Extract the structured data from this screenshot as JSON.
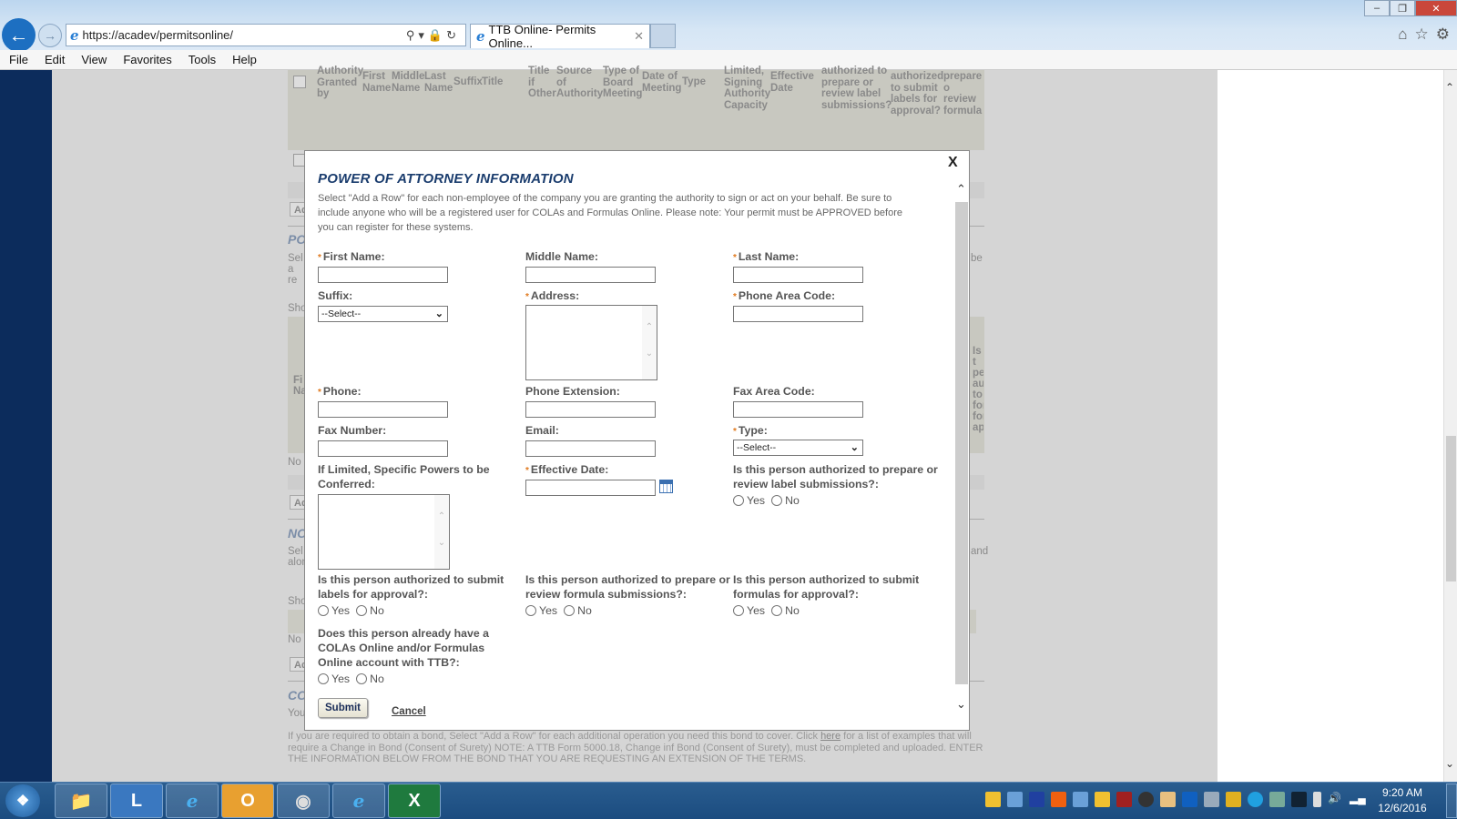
{
  "browser": {
    "url": "https://acadev/permitsonline/",
    "tab_title": "TTB Online- Permits Online...",
    "menu": [
      "File",
      "Edit",
      "View",
      "Favorites",
      "Tools",
      "Help"
    ]
  },
  "background_page": {
    "table_headers": [
      "Authority Granted by",
      "First Name",
      "Middle Name",
      "Last Name",
      "Suffix",
      "Title",
      "Title if Other",
      "Source of Authority",
      "Type of Board Meeting",
      "Date of Meeting",
      "Type",
      "Limited, Signing Authority Capacity",
      "Effective Date",
      "authorized to prepare or review label submissions?",
      "authorized to submit labels for approval?",
      "prepare o review formula submissi"
    ],
    "fragments": {
      "add_btn": "Ad",
      "po_heading": "PO",
      "po_desc": "Sel a re",
      "show1": "Sho",
      "fi_na": "Fi Na",
      "no1": "No",
      "no_heading": "NO",
      "no_desc": "Sel alon",
      "show2": "Sho",
      "no2": "No",
      "co_heading": "CO",
      "you": "You",
      "be": "be",
      "is_col": "Is t pe au to for for ap",
      "and": "and"
    },
    "bond_text_before": "If you are required to obtain a bond, Select \"Add a Row\" for each additional operation you need this bond to cover. Click ",
    "bond_link": "here",
    "bond_text_after": " for a list of examples that will require a Change in Bond (Consent of Surety) NOTE: A TTB Form 5000.18, Change inf Bond (Consent of Surety), must be completed and uploaded. ENTER THE INFORMATION BELOW FROM THE BOND THAT YOU ARE REQUESTING AN EXTENSION OF THE TERMS."
  },
  "modal": {
    "title": "POWER OF ATTORNEY INFORMATION",
    "close": "X",
    "intro": "Select \"Add a Row\" for each non-employee of the company you are granting the authority to sign or act on your behalf. Be sure to include anyone who will be a registered user for COLAs and Formulas Online. Please note: Your permit must be APPROVED before you can register for these systems.",
    "required_marker": "*",
    "labels": {
      "first_name": "First Name:",
      "middle_name": "Middle Name:",
      "last_name": "Last Name:",
      "suffix": "Suffix:",
      "address": "Address:",
      "phone_area": "Phone Area Code:",
      "phone": "Phone:",
      "phone_ext": "Phone Extension:",
      "fax_area": "Fax Area Code:",
      "fax_number": "Fax Number:",
      "email": "Email:",
      "type": "Type:",
      "specific_powers": "If Limited, Specific Powers to be Conferred:",
      "effective_date": "Effective Date:",
      "q_prepare_label": "Is this person authorized to prepare or review label submissions?:",
      "q_submit_label": "Is this person authorized to submit labels for approval?:",
      "q_prepare_formula": "Is this person authorized to prepare or review formula submissions?:",
      "q_submit_formula": "Is this person authorized to submit formulas for approval?:",
      "q_existing_account": "Does this person already have a COLAs Online and/or Formulas Online account with TTB?:"
    },
    "values": {
      "first_name": "",
      "middle_name": "",
      "last_name": "",
      "address": "",
      "phone_area": "",
      "phone": "",
      "phone_ext": "",
      "fax_area": "",
      "fax_number": "",
      "email": "",
      "specific_powers": "",
      "effective_date": ""
    },
    "suffix_selected": "--Select--",
    "type_selected": "--Select--",
    "yes": "Yes",
    "no": "No",
    "submit": "Submit",
    "cancel": "Cancel"
  },
  "taskbar": {
    "apps": [
      "file-explorer",
      "lync",
      "internet-explorer",
      "outlook",
      "app-spiral",
      "internet-explorer-2",
      "excel"
    ],
    "time": "9:20 AM",
    "date": "12/6/2016"
  },
  "colors": {
    "accent": "#1b3d6e",
    "required": "#e07a20",
    "sidebar": "#0c2c5c"
  }
}
